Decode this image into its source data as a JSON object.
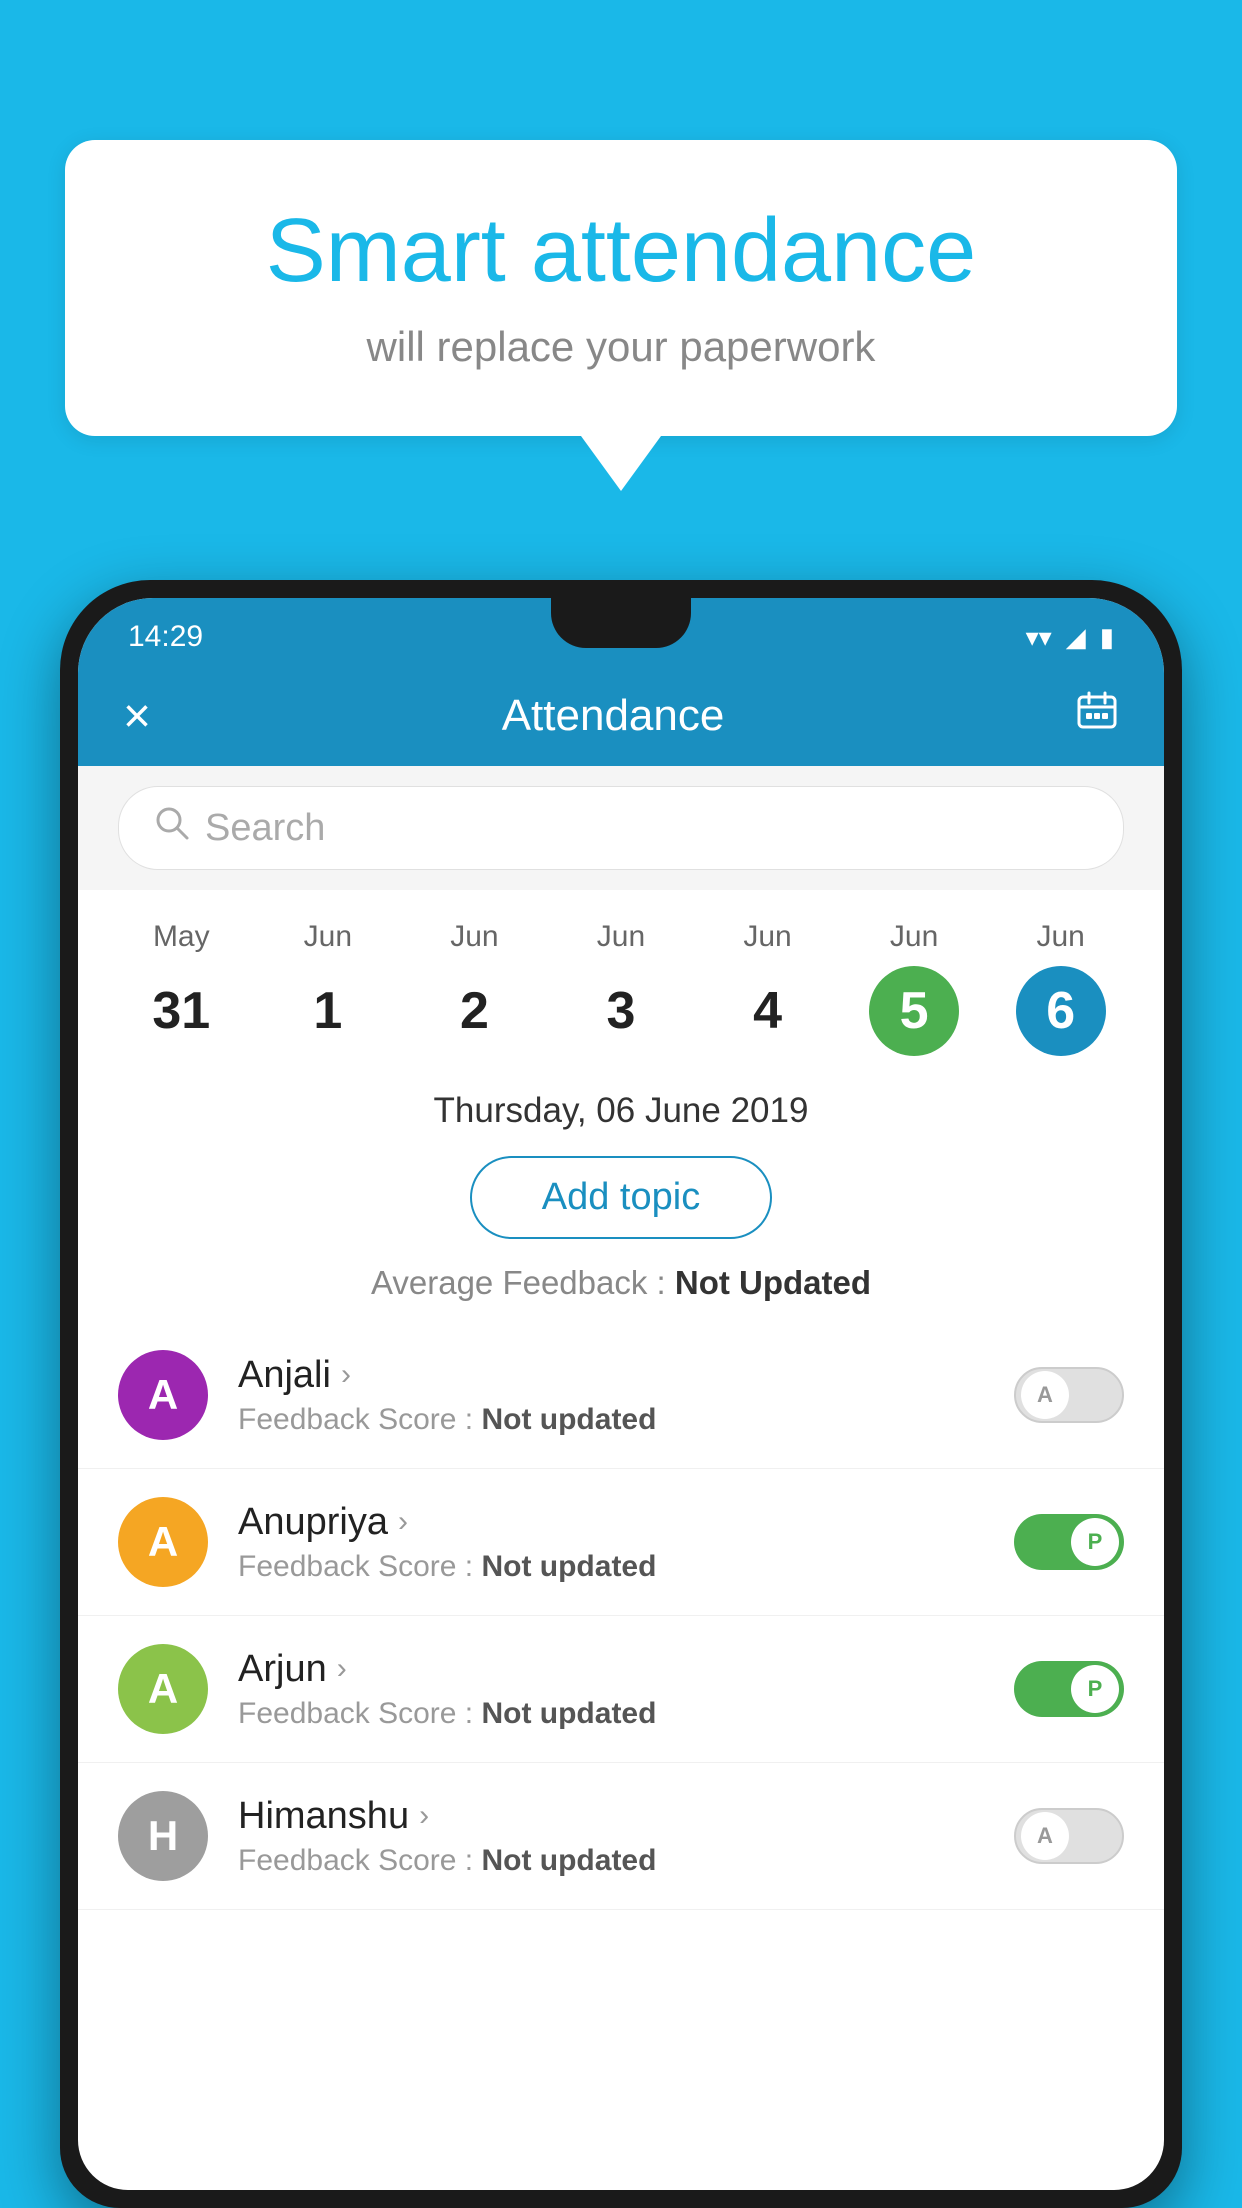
{
  "background_color": "#1ab8e8",
  "speech_bubble": {
    "title": "Smart attendance",
    "subtitle": "will replace your paperwork"
  },
  "status_bar": {
    "time": "14:29",
    "wifi": "▼",
    "signal": "◄",
    "battery": "▮"
  },
  "header": {
    "title": "Attendance",
    "close_label": "×",
    "calendar_label": "📅"
  },
  "search": {
    "placeholder": "Search"
  },
  "calendar": {
    "days": [
      {
        "month": "May",
        "date": "31",
        "state": "normal"
      },
      {
        "month": "Jun",
        "date": "1",
        "state": "normal"
      },
      {
        "month": "Jun",
        "date": "2",
        "state": "normal"
      },
      {
        "month": "Jun",
        "date": "3",
        "state": "normal"
      },
      {
        "month": "Jun",
        "date": "4",
        "state": "normal"
      },
      {
        "month": "Jun",
        "date": "5",
        "state": "today"
      },
      {
        "month": "Jun",
        "date": "6",
        "state": "selected"
      }
    ]
  },
  "selected_date": "Thursday, 06 June 2019",
  "add_topic_label": "Add topic",
  "avg_feedback_label": "Average Feedback : ",
  "avg_feedback_value": "Not Updated",
  "students": [
    {
      "name": "Anjali",
      "avatar_letter": "A",
      "avatar_color": "#9c27b0",
      "feedback": "Not updated",
      "attendance": "A",
      "toggle_state": "off"
    },
    {
      "name": "Anupriya",
      "avatar_letter": "A",
      "avatar_color": "#f5a623",
      "feedback": "Not updated",
      "attendance": "P",
      "toggle_state": "on"
    },
    {
      "name": "Arjun",
      "avatar_letter": "A",
      "avatar_color": "#8bc34a",
      "feedback": "Not updated",
      "attendance": "P",
      "toggle_state": "on"
    },
    {
      "name": "Himanshu",
      "avatar_letter": "H",
      "avatar_color": "#9e9e9e",
      "feedback": "Not updated",
      "attendance": "A",
      "toggle_state": "off"
    }
  ],
  "feedback_score_label": "Feedback Score : ",
  "feedback_score_value": "Not updated"
}
